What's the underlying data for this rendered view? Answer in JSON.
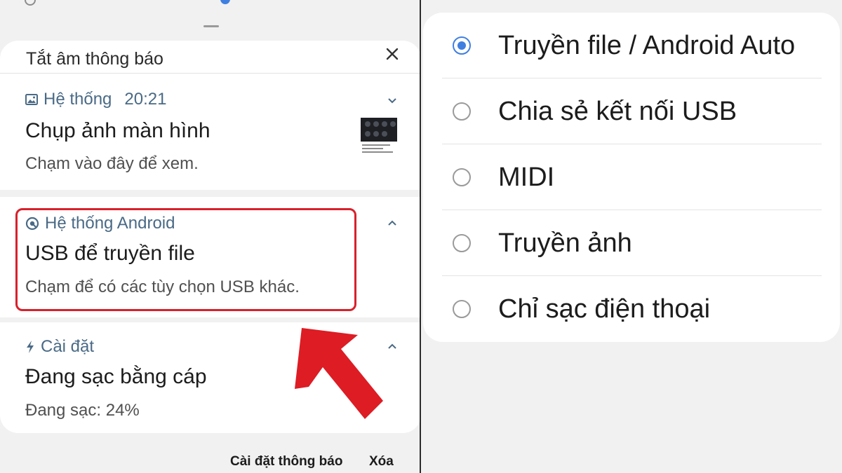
{
  "left": {
    "silent_header": {
      "title": "Tắt âm thông báo",
      "close_icon": "close-icon"
    },
    "notifications": [
      {
        "app": "Hệ thống",
        "time": "20:21",
        "icon": "image-icon",
        "title": "Chụp ảnh màn hình",
        "text": "Chạm vào đây để xem.",
        "expand_icon": "chevron-down-icon"
      },
      {
        "app": "Hệ thống Android",
        "icon": "android-system-icon",
        "title": "USB để truyền file",
        "text": "Chạm để có các tùy chọn USB khác.",
        "expand_icon": "chevron-up-icon",
        "highlighted": true
      },
      {
        "app": "Cài đặt",
        "icon": "bolt-icon",
        "title": "Đang sạc bằng cáp",
        "text": "Đang sạc: 24%",
        "expand_icon": "chevron-up-icon"
      }
    ],
    "footer": {
      "settings_label": "Cài đặt thông báo",
      "clear_label": "Xóa"
    }
  },
  "right": {
    "usb_options": [
      {
        "label": "Truyền file / Android Auto",
        "selected": true
      },
      {
        "label": "Chia sẻ kết nối USB",
        "selected": false
      },
      {
        "label": "MIDI",
        "selected": false
      },
      {
        "label": "Truyền ảnh",
        "selected": false
      },
      {
        "label": "Chỉ sạc điện thoại",
        "selected": false
      }
    ]
  },
  "colors": {
    "accent": "#3f7fe0",
    "highlight": "#d8212b",
    "app_label": "#4a6a86"
  }
}
